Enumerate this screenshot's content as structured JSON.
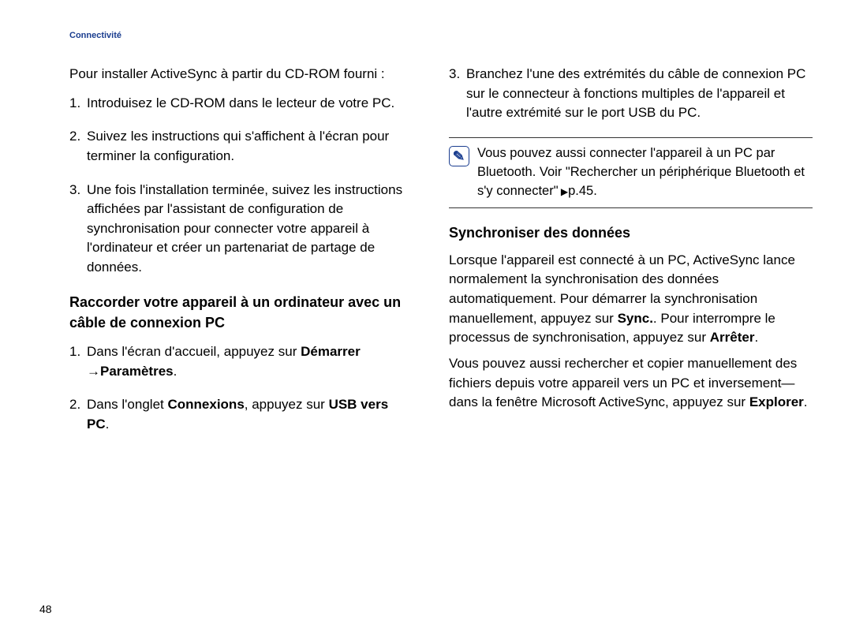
{
  "header": {
    "section": "Connectivité"
  },
  "left": {
    "intro": "Pour installer ActiveSync à partir du CD-ROM fourni :",
    "steps": [
      "Introduisez le CD-ROM dans le lecteur de votre PC.",
      "Suivez les instructions qui s'affichent à l'écran pour terminer la configuration.",
      "Une fois l'installation terminée, suivez les instructions affichées par l'assistant de configuration de synchronisation pour connecter votre appareil à l'ordinateur et créer un partenariat de partage de données."
    ],
    "subheading": "Raccorder votre appareil à un ordinateur avec un câble de connexion PC",
    "steps2": {
      "s1_pre": "Dans l'écran d'accueil, appuyez sur ",
      "s1_b1": "Démarrer",
      "s1_b2": "Paramètres",
      "s1_post": ".",
      "s2_pre": "Dans l'onglet ",
      "s2_b1": "Connexions",
      "s2_mid": ", appuyez sur ",
      "s2_b2": "USB vers PC",
      "s2_post": "."
    }
  },
  "right": {
    "step3": "Branchez l'une des extrémités du câble de connexion PC sur le connecteur à fonctions multiples de l'appareil et l'autre extrémité sur le port USB du PC.",
    "note_pre": "Vous pouvez aussi connecter l'appareil à un PC par Bluetooth. Voir \"Rechercher un périphérique Bluetooth et s'y connecter\"",
    "note_page": "p.45.",
    "subheading": "Synchroniser des données",
    "p1_pre": "Lorsque l'appareil est connecté à un PC, ActiveSync lance normalement la synchronisation des données automatiquement. Pour démarrer la synchronisation manuellement, appuyez sur ",
    "p1_b1": "Sync.",
    "p1_mid": ". Pour interrompre le processus de synchronisation, appuyez sur ",
    "p1_b2": "Arrêter",
    "p1_post": ".",
    "p2_pre": "Vous pouvez aussi rechercher et copier manuellement des fichiers depuis votre appareil vers un PC et inversement—dans la fenêtre Microsoft ActiveSync, appuyez sur ",
    "p2_b1": "Explorer",
    "p2_post": "."
  },
  "page_number": "48"
}
